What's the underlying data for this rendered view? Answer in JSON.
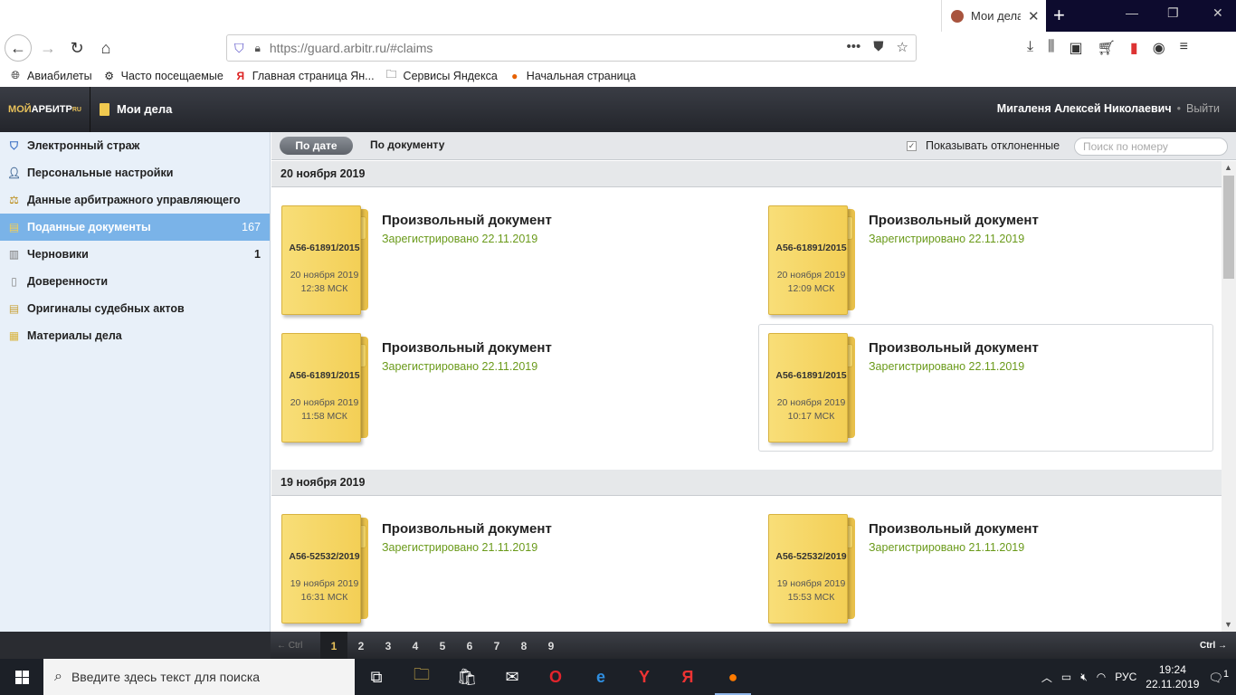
{
  "browser": {
    "tab_title": "Мои дела",
    "url": "https://guard.arbitr.ru/#claims",
    "bookmarks": [
      {
        "label": "Авиабилеты",
        "icon": "globe-icon"
      },
      {
        "label": "Часто посещаемые",
        "icon": "gear-icon"
      },
      {
        "label": "Главная страница Ян...",
        "icon": "yandex-icon"
      },
      {
        "label": "Сервисы Яндекса",
        "icon": "folder-icon"
      },
      {
        "label": "Начальная страница",
        "icon": "firefox-icon"
      }
    ]
  },
  "header": {
    "logo_moi": "МОЙ",
    "logo_arbitr": "АРБИТР",
    "logo_ru": "RU",
    "section_title": "Мои дела",
    "user_name": "Мигаленя Алексей Николаевич",
    "separator": "•",
    "logout": "Выйти"
  },
  "sidebar": {
    "items": [
      {
        "label": "Электронный страж",
        "icon": "shield-icon",
        "count": ""
      },
      {
        "label": "Персональные настройки",
        "icon": "user-icon",
        "count": ""
      },
      {
        "label": "Данные арбитражного управляющего",
        "icon": "scales-icon",
        "count": ""
      },
      {
        "label": "Поданные документы",
        "icon": "inbox-icon",
        "count": "167"
      },
      {
        "label": "Черновики",
        "icon": "drafts-icon",
        "count": "1"
      },
      {
        "label": "Доверенности",
        "icon": "document-icon",
        "count": ""
      },
      {
        "label": "Оригиналы судебных актов",
        "icon": "court-acts-icon",
        "count": ""
      },
      {
        "label": "Материалы дела",
        "icon": "case-materials-icon",
        "count": ""
      }
    ]
  },
  "filters": {
    "by_date": "По дате",
    "by_document": "По документу",
    "show_declined_label": "Показывать отклоненные",
    "show_declined_checked": true,
    "search_placeholder": "Поиск по номеру"
  },
  "groups": [
    {
      "date": "20 ноября 2019",
      "cards": [
        {
          "case": "А56-61891/2015",
          "date": "20 ноября 2019",
          "time": "12:38 МСК",
          "title": "Произвольный документ",
          "status": "Зарегистрировано 22.11.2019"
        },
        {
          "case": "А56-61891/2015",
          "date": "20 ноября 2019",
          "time": "12:09 МСК",
          "title": "Произвольный документ",
          "status": "Зарегистрировано 22.11.2019"
        },
        {
          "case": "А56-61891/2015",
          "date": "20 ноября 2019",
          "time": "11:58 МСК",
          "title": "Произвольный документ",
          "status": "Зарегистрировано 22.11.2019"
        },
        {
          "case": "А56-61891/2015",
          "date": "20 ноября 2019",
          "time": "10:17 МСК",
          "title": "Произвольный документ",
          "status": "Зарегистрировано 22.11.2019"
        }
      ]
    },
    {
      "date": "19 ноября 2019",
      "cards": [
        {
          "case": "А56-52532/2019",
          "date": "19 ноября 2019",
          "time": "16:31 МСК",
          "title": "Произвольный документ",
          "status": "Зарегистрировано 21.11.2019"
        },
        {
          "case": "А56-52532/2019",
          "date": "19 ноября 2019",
          "time": "15:53 МСК",
          "title": "Произвольный документ",
          "status": "Зарегистрировано 21.11.2019"
        }
      ]
    }
  ],
  "pager": {
    "prev": "← Ctrl",
    "next": "Ctrl →",
    "pages": [
      "1",
      "2",
      "3",
      "4",
      "5",
      "6",
      "7",
      "8",
      "9"
    ],
    "current": "1"
  },
  "taskbar": {
    "search_placeholder": "Введите здесь текст для поиска",
    "lang": "РУС",
    "time": "19:24",
    "date": "22.11.2019",
    "notifications": "1"
  },
  "colors": {
    "accent_sidebar_active": "#7ab3e8",
    "status_green": "#6a9a1a",
    "folder_yellow": "#f3cf56",
    "header_dark": "#2b2d33"
  }
}
